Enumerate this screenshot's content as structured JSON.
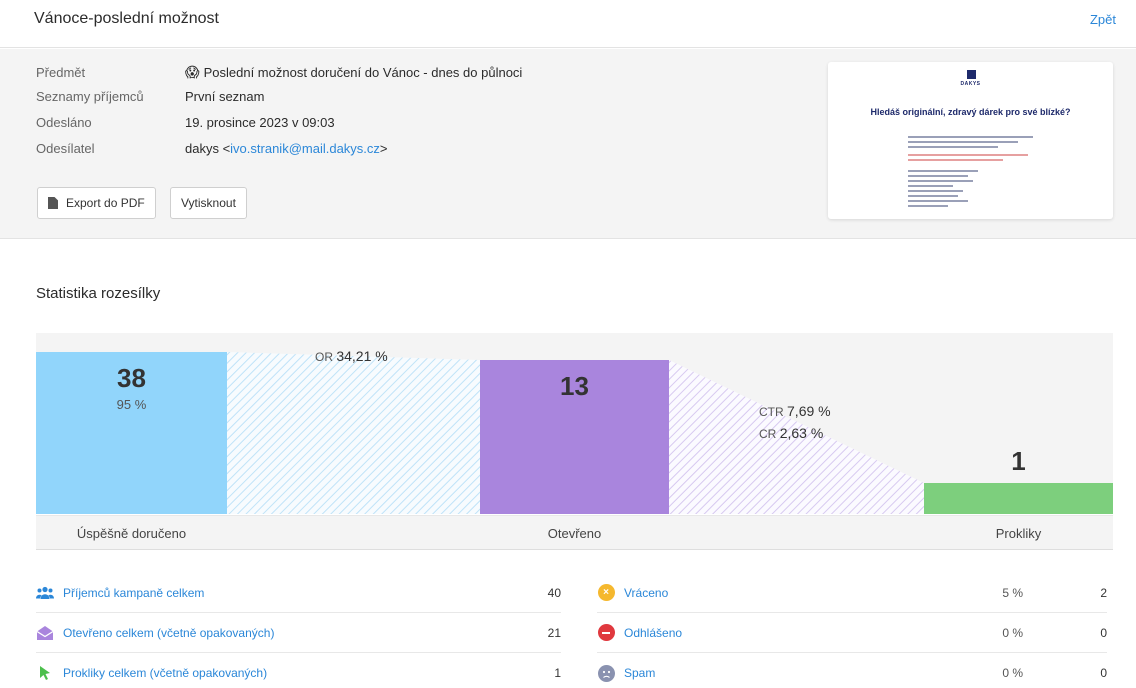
{
  "header": {
    "title": "Vánoce-poslední možnost",
    "back_label": "Zpět"
  },
  "meta": {
    "subject_label": "Předmět",
    "subject_emoji": "😱",
    "subject_value": "Poslední možnost doručení do Vánoc - dnes do půlnoci",
    "lists_label": "Seznamy příjemců",
    "lists_value": "První seznam",
    "sent_label": "Odesláno",
    "sent_value": "19. prosince 2023 v 09:03",
    "sender_label": "Odesílatel",
    "sender_name": "dakys <",
    "sender_email": "ivo.stranik@mail.dakys.cz",
    "sender_suffix": ">",
    "export_label": "Export do PDF",
    "print_label": "Vytisknout"
  },
  "preview": {
    "brand": "DAKYS",
    "headline": "Hledáš originální, zdravý dárek pro své blízké?"
  },
  "stats_section": {
    "title": "Statistika rozesílky"
  },
  "funnel": {
    "delivered": {
      "count": "38",
      "pct": "95 %",
      "label": "Úspěšně doručeno",
      "color": "#91d5fb"
    },
    "opened": {
      "count": "13",
      "label": "Otevřeno",
      "color": "#a985dd"
    },
    "clicks": {
      "count": "1",
      "label": "Prokliky",
      "color": "#7dcf7d"
    },
    "or_label": "OR",
    "or_value": "34,21 %",
    "ctr_label": "CTR",
    "ctr_value": "7,69 %",
    "cr_label": "CR",
    "cr_value": "2,63 %"
  },
  "stats_left": [
    {
      "label": "Příjemců kampaně celkem",
      "value": "40",
      "icon": "people-icon"
    },
    {
      "label": "Otevřeno celkem (včetně opakovaných)",
      "value": "21",
      "icon": "envelope-open-icon"
    },
    {
      "label": "Prokliky celkem (včetně opakovaných)",
      "value": "1",
      "icon": "cursor-icon"
    }
  ],
  "stats_right": [
    {
      "label": "Vráceno",
      "pct": "5 %",
      "value": "2",
      "icon": "bounce-icon",
      "color": "#f5b82e"
    },
    {
      "label": "Odhlášeno",
      "pct": "0 %",
      "value": "0",
      "icon": "unsubscribe-icon",
      "color": "#e0383e"
    },
    {
      "label": "Spam",
      "pct": "0 %",
      "value": "0",
      "icon": "spam-icon",
      "color": "#8a92b0"
    }
  ]
}
